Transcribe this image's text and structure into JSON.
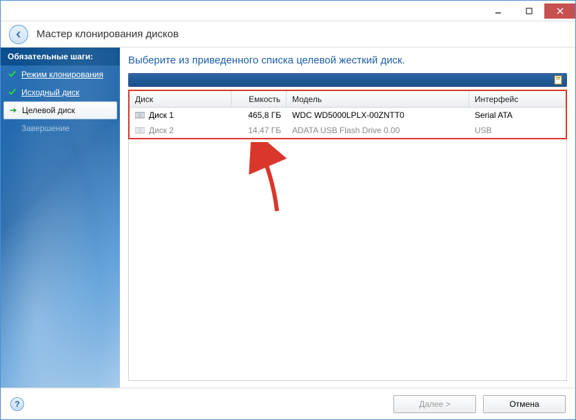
{
  "window": {
    "title": "Мастер клонирования дисков"
  },
  "sidebar": {
    "header": "Обязательные шаги:",
    "steps": [
      {
        "label": "Режим клонирования",
        "state": "done"
      },
      {
        "label": "Исходный диск",
        "state": "done"
      },
      {
        "label": "Целевой диск",
        "state": "current"
      },
      {
        "label": "Завершение",
        "state": "disabled"
      }
    ]
  },
  "main": {
    "instruction": "Выберите из приведенного списка целевой жесткий диск."
  },
  "table": {
    "columns": {
      "disk": "Диск",
      "capacity": "Емкость",
      "model": "Модель",
      "interface": "Интерфейс"
    },
    "rows": [
      {
        "disk": "Диск 1",
        "capacity": "465,8 ГБ",
        "model": "WDC WD5000LPLX-00ZNTT0",
        "interface": "Serial ATA",
        "dim": false
      },
      {
        "disk": "Диск 2",
        "capacity": "14,47 ГБ",
        "model": "ADATA USB Flash Drive 0.00",
        "interface": "USB",
        "dim": true
      }
    ]
  },
  "footer": {
    "next": "Далее >",
    "cancel": "Отмена"
  }
}
